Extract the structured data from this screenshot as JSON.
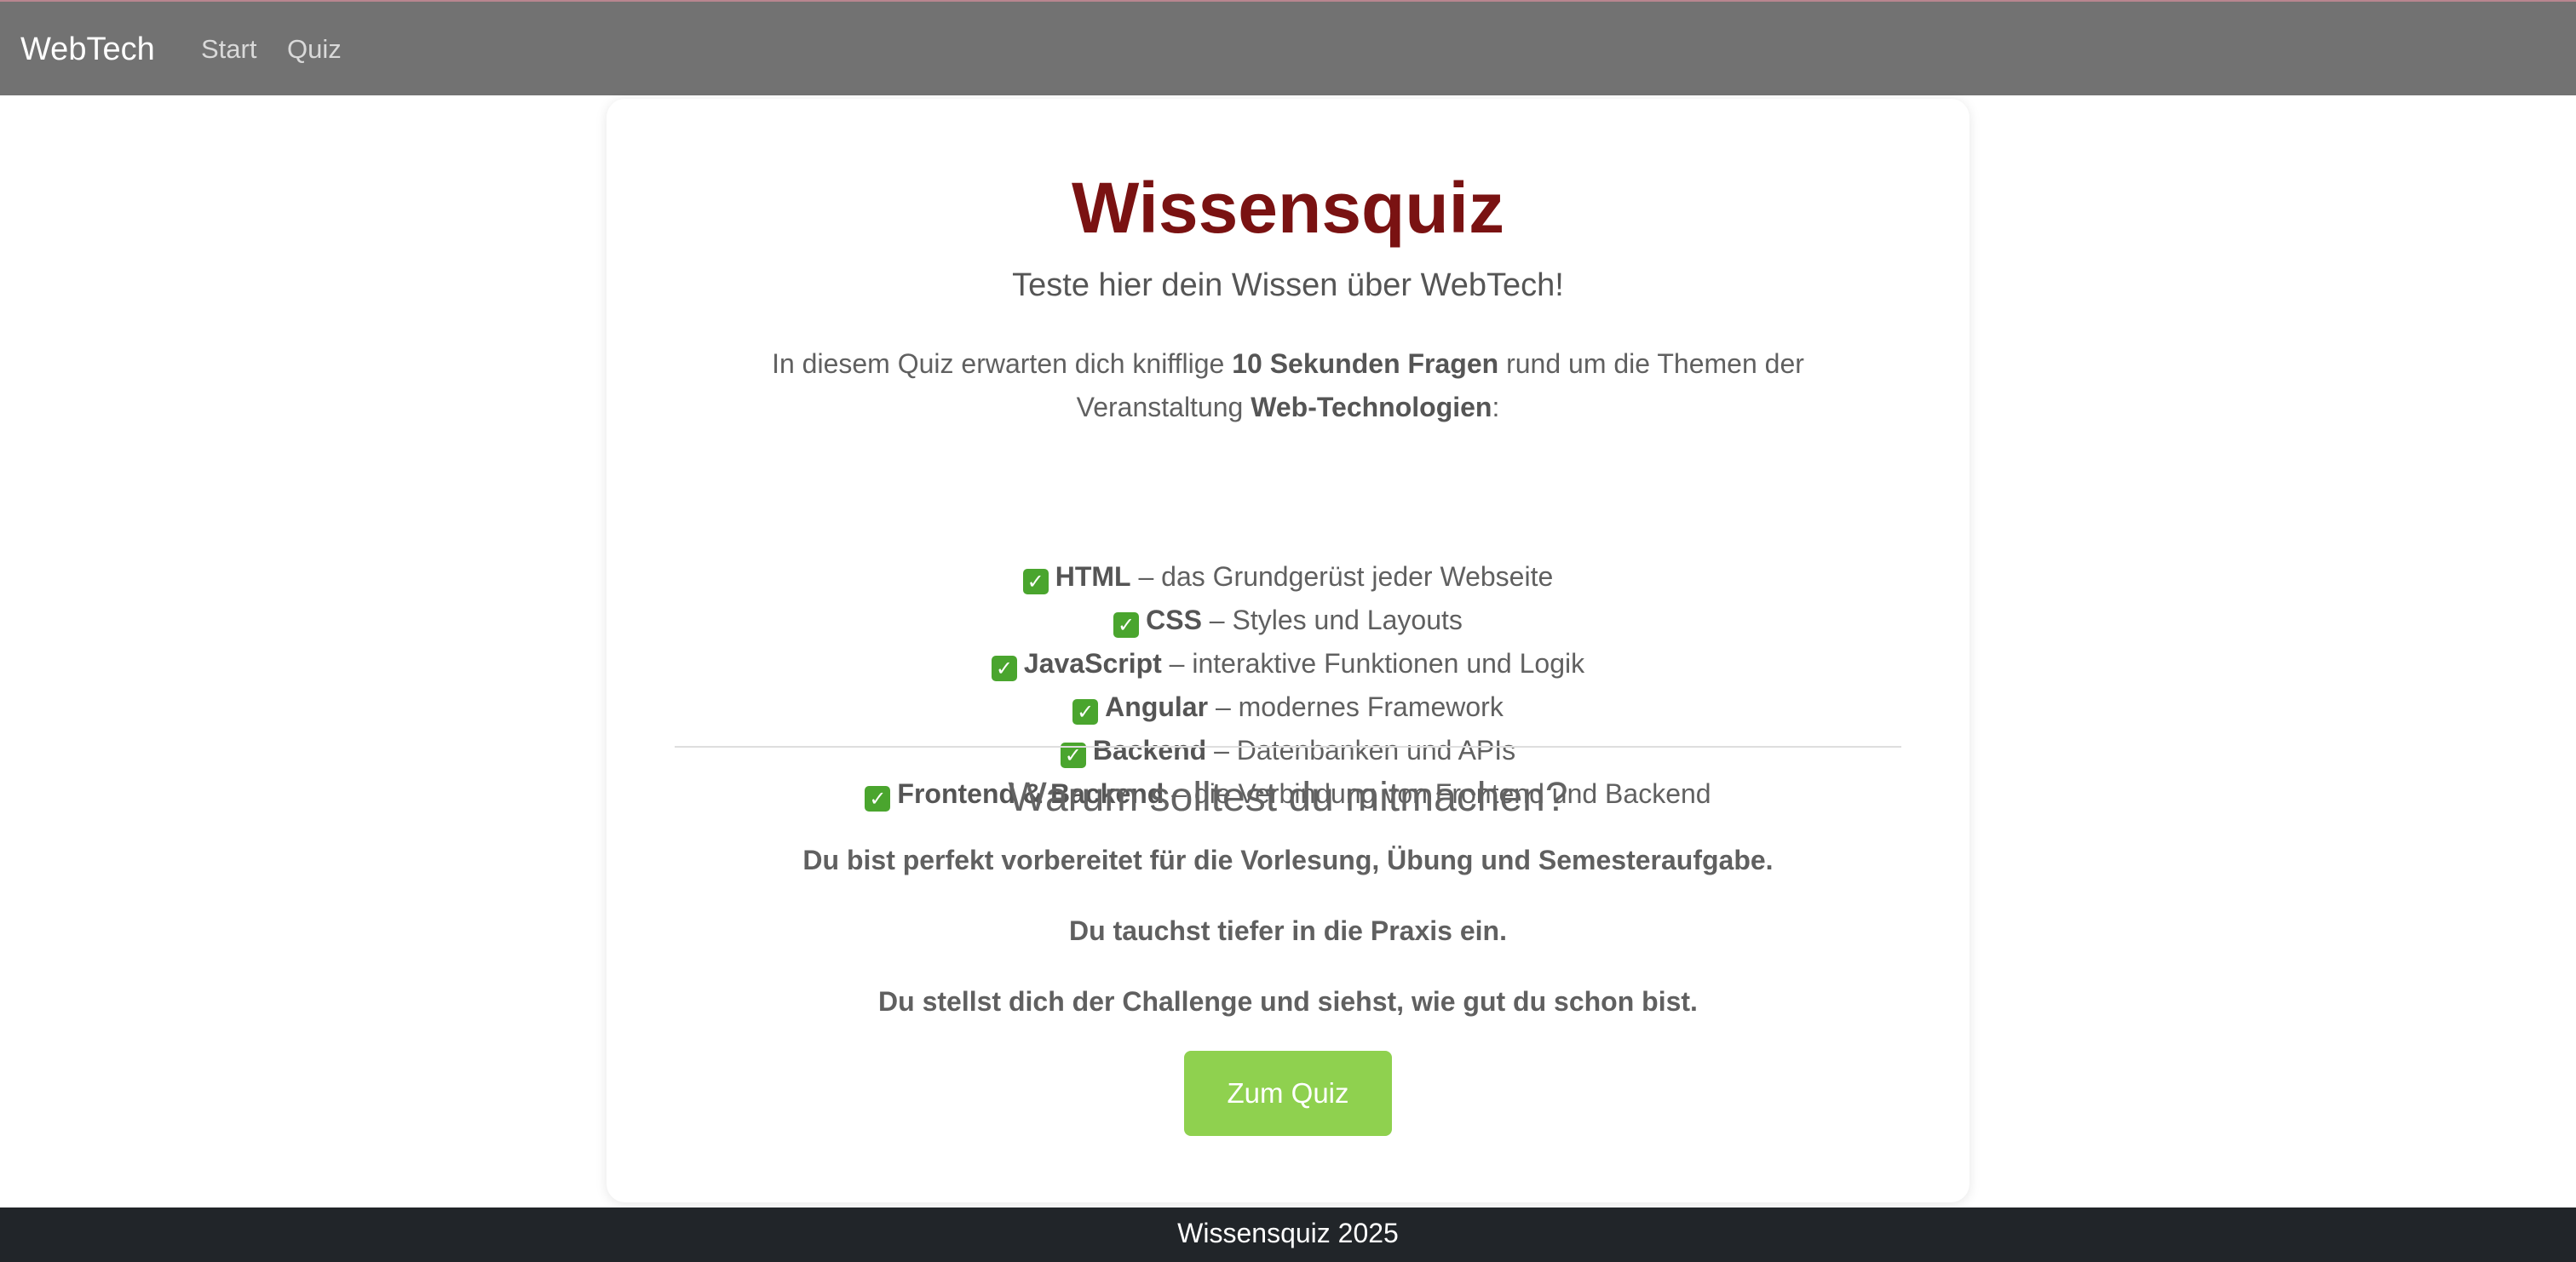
{
  "navbar": {
    "brand": "WebTech",
    "links": [
      {
        "label": "Start"
      },
      {
        "label": "Quiz"
      }
    ]
  },
  "card": {
    "title": "Wissensquiz",
    "subtitle": "Teste hier dein Wissen über WebTech!",
    "intro": {
      "text_1": "In diesem Quiz erwarten dich knifflige ",
      "bold_1": "10 Sekunden Fragen",
      "text_2": " rund um die Themen der Veranstaltung ",
      "bold_2": "Web-Technologien",
      "text_3": ":"
    },
    "check_icon": "✓",
    "topics": [
      {
        "name": "HTML",
        "description": " – das Grundgerüst jeder Webseite"
      },
      {
        "name": "CSS",
        "description": " – Styles und Layouts"
      },
      {
        "name": "JavaScript",
        "description": " – interaktive Funktionen und Logik"
      },
      {
        "name": "Angular",
        "description": " – modernes Framework"
      },
      {
        "name": "Backend",
        "description": " – Datenbanken und APIs"
      },
      {
        "name": "Frontend & Backend",
        "description": " – die Verbindung von Frontend und Backend"
      }
    ],
    "why_heading": "Warum solltest du mitmachen?",
    "reasons": [
      "Du bist perfekt vorbereitet für die Vorlesung, Übung und Semesteraufgabe.",
      "Du tauchst tiefer in die Praxis ein.",
      "Du stellst dich der Challenge und siehst, wie gut du schon bist."
    ],
    "button_label": "Zum Quiz"
  },
  "footer": {
    "text": "Wissensquiz 2025"
  },
  "colors": {
    "navbar": "#727272",
    "title": "#7a1212",
    "button": "#8fd14f",
    "check": "#4aa52e",
    "footer": "#212529"
  }
}
